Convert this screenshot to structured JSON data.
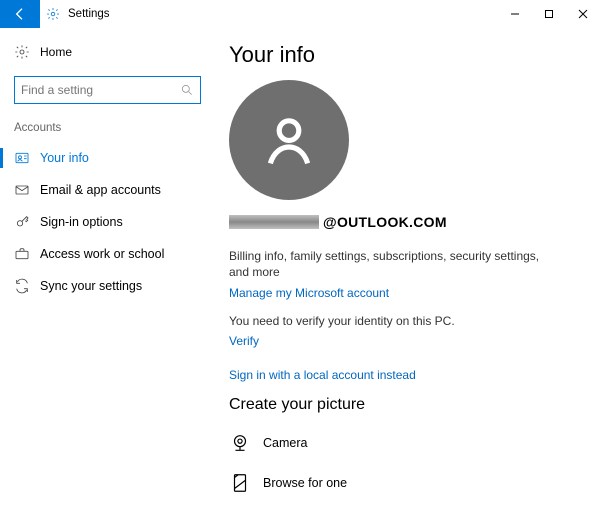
{
  "titlebar": {
    "title": "Settings"
  },
  "nav": {
    "home": "Home",
    "search_placeholder": "Find a setting",
    "section": "Accounts",
    "items": [
      {
        "label": "Your info"
      },
      {
        "label": "Email & app accounts"
      },
      {
        "label": "Sign-in options"
      },
      {
        "label": "Access work or school"
      },
      {
        "label": "Sync your settings"
      }
    ]
  },
  "main": {
    "heading": "Your info",
    "email_domain": "@OUTLOOK.COM",
    "billing_desc": "Billing info, family settings, subscriptions, security settings, and more",
    "manage_link": "Manage my Microsoft account",
    "verify_desc": "You need to verify your identity on this PC.",
    "verify_link": "Verify",
    "local_link": "Sign in with a local account instead",
    "picture_heading": "Create your picture",
    "camera": "Camera",
    "browse": "Browse for one"
  }
}
